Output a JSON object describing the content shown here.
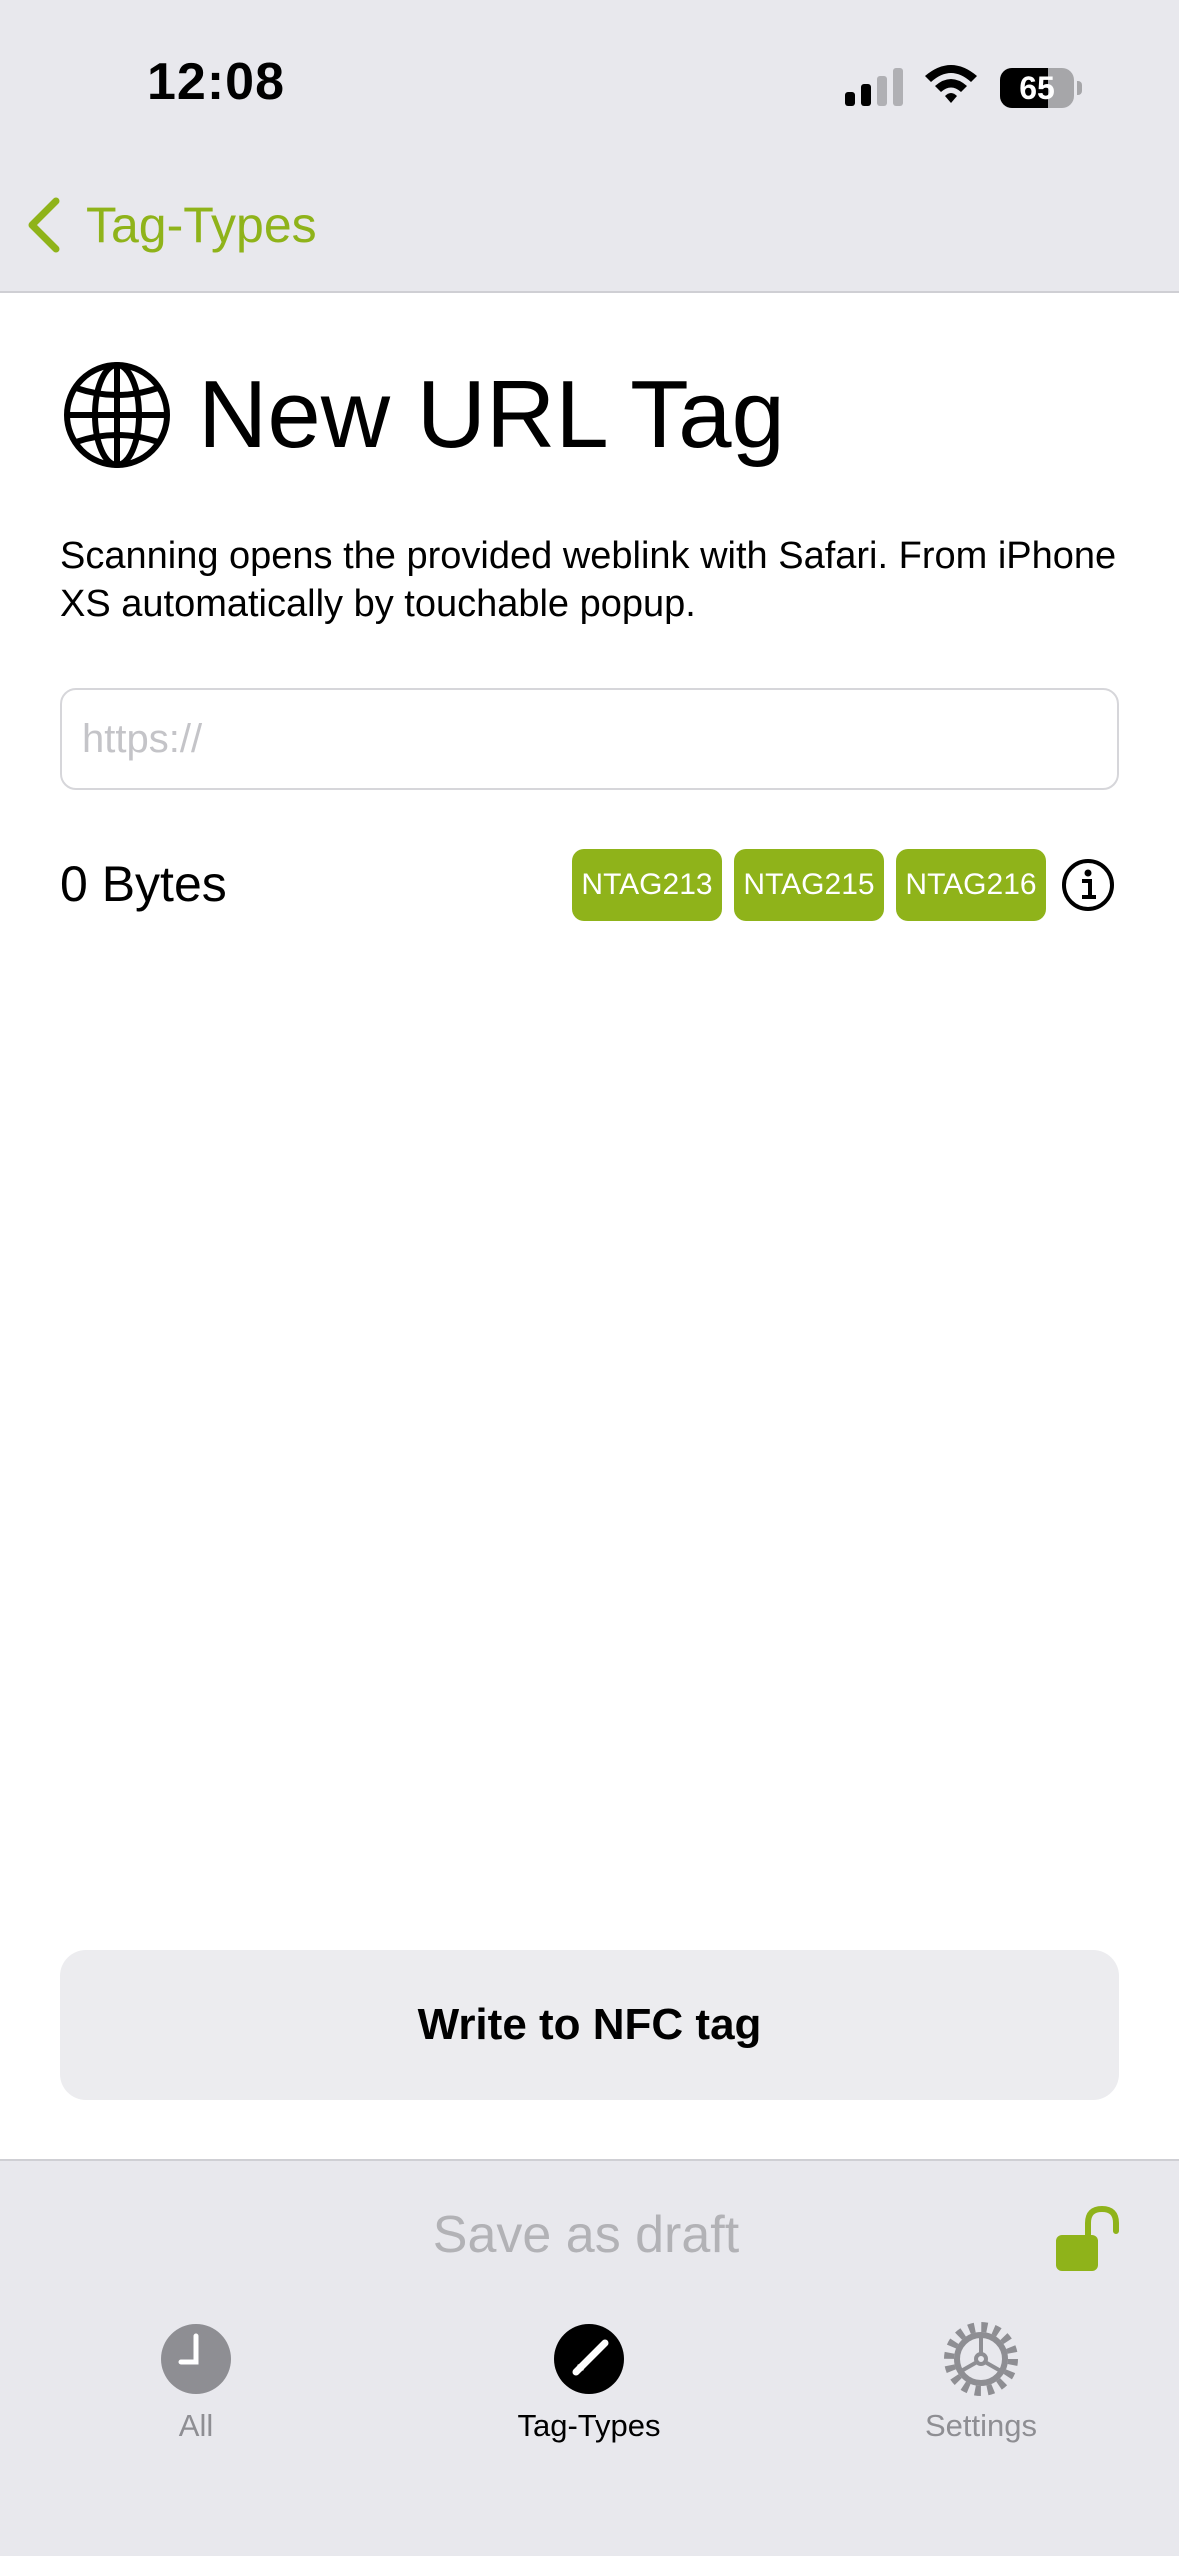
{
  "status_bar": {
    "time": "12:08",
    "battery": "65",
    "battery_level": 0.65
  },
  "nav": {
    "back_label": "Tag-Types"
  },
  "header": {
    "title": "New URL Tag",
    "icon": "globe-icon"
  },
  "description": "Scanning opens the provided weblink with Safari. From iPhone XS automatically by touchable popup.",
  "url_field": {
    "value": "",
    "placeholder": "https://"
  },
  "size_info": {
    "bytes_label": "0 Bytes",
    "chips": [
      "NTAG213",
      "NTAG215",
      "NTAG216"
    ],
    "info_icon": "info-icon"
  },
  "actions": {
    "write_label": "Write to NFC tag",
    "draft_label": "Save as draft",
    "lock_icon": "unlocked-lock-icon"
  },
  "tab_bar": {
    "active": "Tag-Types",
    "items": [
      {
        "label": "All",
        "icon": "clock-icon"
      },
      {
        "label": "Tag-Types",
        "icon": "pencil-icon"
      },
      {
        "label": "Settings",
        "icon": "gear-icon"
      }
    ]
  },
  "colors": {
    "accent": "#8fb31a",
    "bar_background": "#e8e8ed",
    "inactive": "#8e8e93",
    "placeholder": "#c4c4c8"
  }
}
